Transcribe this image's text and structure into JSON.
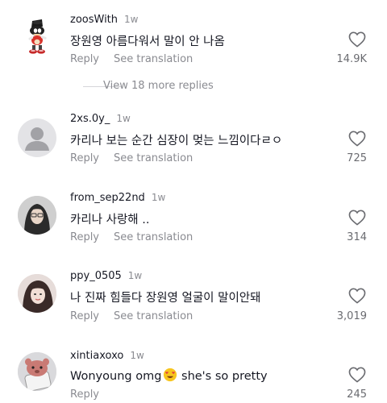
{
  "comments": [
    {
      "username": "zoosWith",
      "time": "1w",
      "text": "장원영 아름다워서 말이 안 나옴",
      "likes": "14.9K",
      "reply_label": "Reply",
      "translate_label": "See translation"
    },
    {
      "username": "2xs.0y_",
      "time": "1w",
      "text": "카리나 보는 순간 심장이 멎는 느낌이다ㄹㅇ",
      "likes": "725",
      "reply_label": "Reply",
      "translate_label": "See translation"
    },
    {
      "username": "from_sep22nd",
      "time": "1w",
      "text": "카리나 사랑해 ..",
      "likes": "314",
      "reply_label": "Reply",
      "translate_label": "See translation"
    },
    {
      "username": "ppy_0505",
      "time": "1w",
      "text": "나 진짜 힘들다 장원영 얼굴이 말이안돼",
      "likes": "3,019",
      "reply_label": "Reply",
      "translate_label": "See translation"
    },
    {
      "username": "xintiaxoxo",
      "time": "1w",
      "text_before": "Wonyoung omg",
      "text_after": " she's so pretty",
      "likes": "245",
      "reply_label": "Reply"
    }
  ],
  "view_replies": "View 18 more replies",
  "icons": {
    "heart": "heart-outline-icon",
    "emoji": "heart-eyes-emoji"
  }
}
